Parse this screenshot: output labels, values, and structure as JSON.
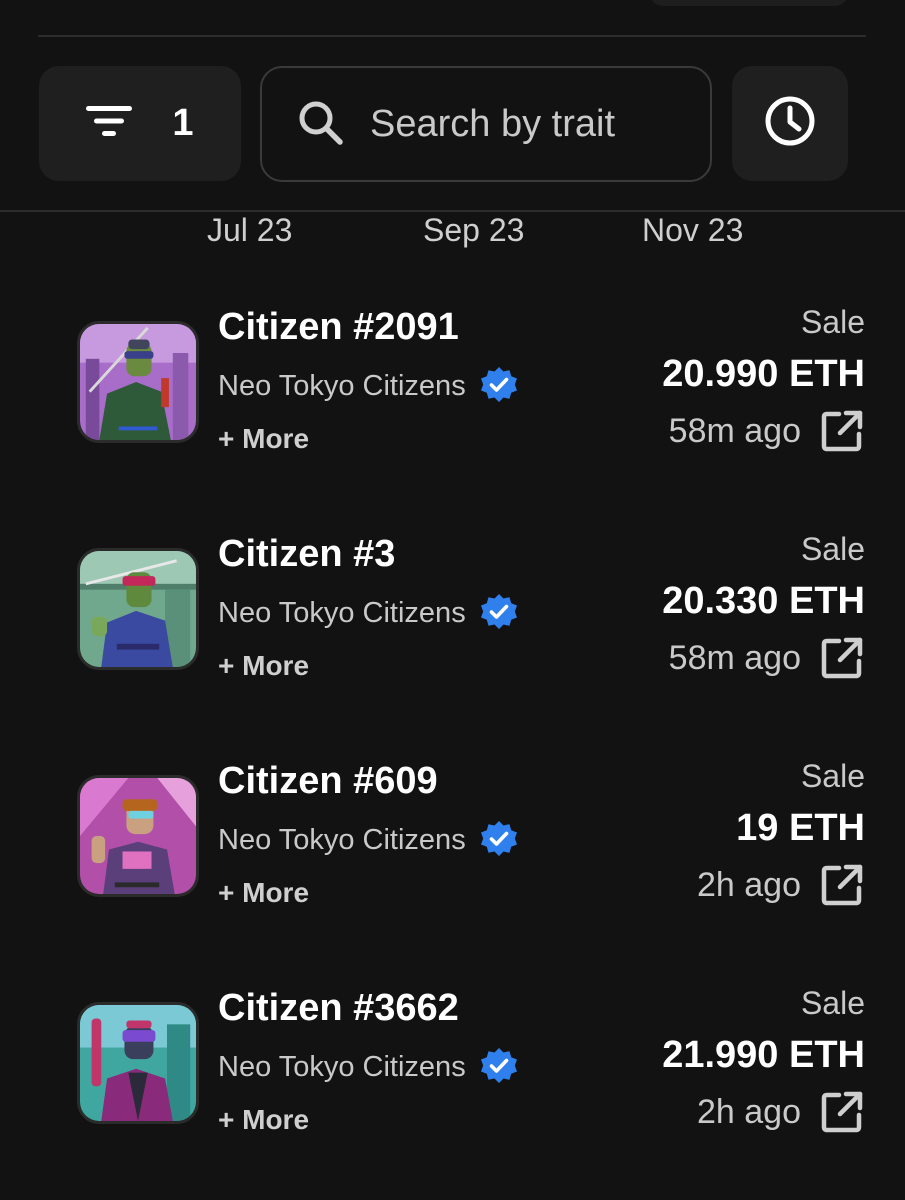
{
  "colors": {
    "background": "#121212",
    "surface": "#1f1f1f",
    "text_primary": "#ffffff",
    "text_secondary": "#c9c9c9",
    "verified_badge": "#2f80ed"
  },
  "toolbar": {
    "filter_count": "1",
    "search_placeholder": "Search by trait"
  },
  "timeline_labels": [
    "Jul 23",
    "Sep 23",
    "Nov 23"
  ],
  "activity": [
    {
      "name": "Citizen #2091",
      "collection": "Neo Tokyo Citizens",
      "more": "+ More",
      "event": "Sale",
      "price": "20.990 ETH",
      "time": "58m ago"
    },
    {
      "name": "Citizen #3",
      "collection": "Neo Tokyo Citizens",
      "more": "+ More",
      "event": "Sale",
      "price": "20.330 ETH",
      "time": "58m ago"
    },
    {
      "name": "Citizen #609",
      "collection": "Neo Tokyo Citizens",
      "more": "+ More",
      "event": "Sale",
      "price": "19 ETH",
      "time": "2h ago"
    },
    {
      "name": "Citizen #3662",
      "collection": "Neo Tokyo Citizens",
      "more": "+ More",
      "event": "Sale",
      "price": "21.990 ETH",
      "time": "2h ago"
    }
  ]
}
